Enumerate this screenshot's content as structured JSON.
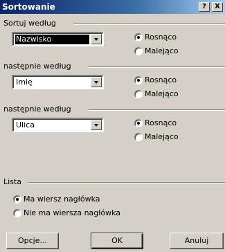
{
  "dialog": {
    "title": "Sortowanie",
    "help_button": "?",
    "close_button": "X"
  },
  "sort_by": {
    "label": "Sortuj według",
    "field": "Nazwisko",
    "ascending": "Rosnąco",
    "descending": "Malejąco",
    "selected": "ascending"
  },
  "then_by_1": {
    "label": "następnie według",
    "field": "Imię",
    "ascending": "Rosnąco",
    "descending": "Malejąco",
    "selected": "ascending"
  },
  "then_by_2": {
    "label": "następnie według",
    "field": "Ulica",
    "ascending": "Rosnąco",
    "descending": "Malejąco",
    "selected": "ascending"
  },
  "list": {
    "label": "Lista",
    "has_header": "Ma wiersz nagłówka",
    "no_header": "Nie ma wiersza nagłówka",
    "selected": "has_header"
  },
  "buttons": {
    "options": "Opcje...",
    "ok": "OK",
    "cancel": "Anuluj"
  }
}
